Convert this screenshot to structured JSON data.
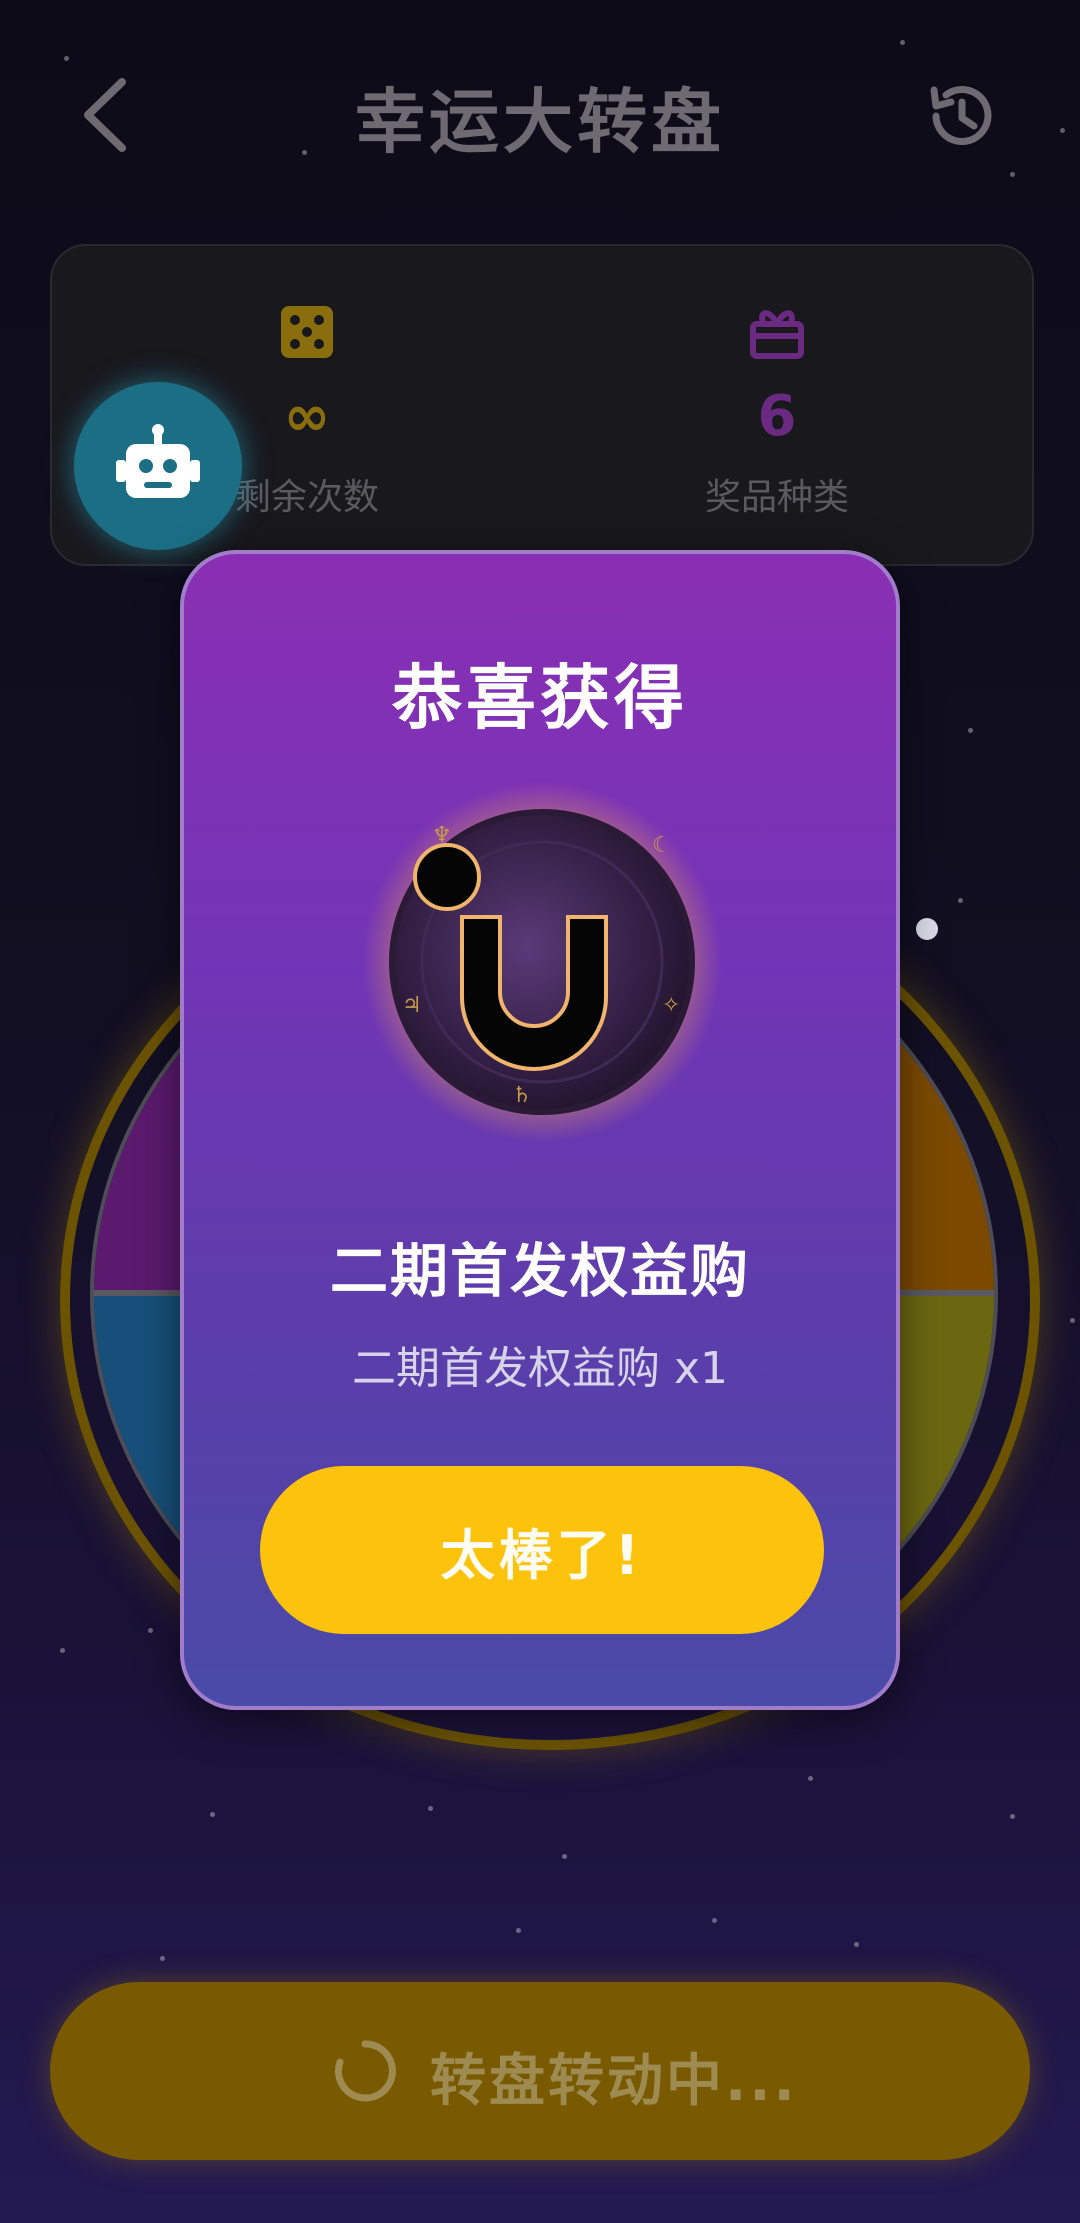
{
  "header": {
    "title": "幸运大转盘",
    "back_icon": "chevron-left-icon",
    "history_icon": "history-clock-icon"
  },
  "stats": {
    "remaining": {
      "icon": "dice-icon",
      "value": "∞",
      "label": "剩余次数",
      "color": "#8a6d0c"
    },
    "prize_types": {
      "icon": "gift-icon",
      "value": "6",
      "label": "奖品种类",
      "color": "#6b2a82"
    }
  },
  "assistant": {
    "icon": "robot-icon"
  },
  "modal": {
    "title": "恭喜获得",
    "prize_name": "二期首发权益购",
    "prize_detail": "二期首发权益购 x1",
    "confirm_label": "太棒了!"
  },
  "spin_button": {
    "label": "转盘转动中...",
    "icon": "loading-spinner-icon"
  },
  "colors": {
    "accent_yellow": "#fdc30c",
    "modal_purple": "#7334b6"
  }
}
